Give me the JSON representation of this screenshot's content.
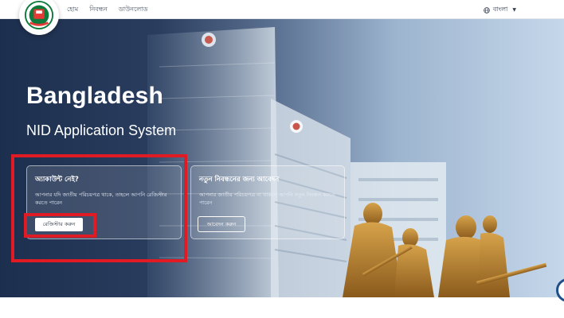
{
  "nav": {
    "links": [
      "হোম",
      "নিবন্ধন",
      "ডাউনলোড"
    ],
    "language": "বাংলা"
  },
  "hero": {
    "title": "Bangladesh",
    "subtitle": "NID Application System"
  },
  "cards": [
    {
      "title": "অ্যাকাউন্ট নেই?",
      "text": "আপনার যদি জাতীয় পরিচয়পত্র থাকে, তাহলে আপনি রেজিস্টার করতে পারেন",
      "button": "রেজিস্টার করুন"
    },
    {
      "title": "নতুন নিবন্ধনের জন্য আবেদন",
      "text": "আপনার জাতীয় পরিচয়পত্র না থাকলে আপনি নতুন নিবন্ধন করতে পারেন",
      "button": "আবেদন করুন"
    }
  ],
  "colors": {
    "highlight": "#e01b24",
    "nav_text": "#4b5563"
  },
  "icons": [
    "globe-icon",
    "caret-down-icon",
    "election-commission-logo"
  ]
}
